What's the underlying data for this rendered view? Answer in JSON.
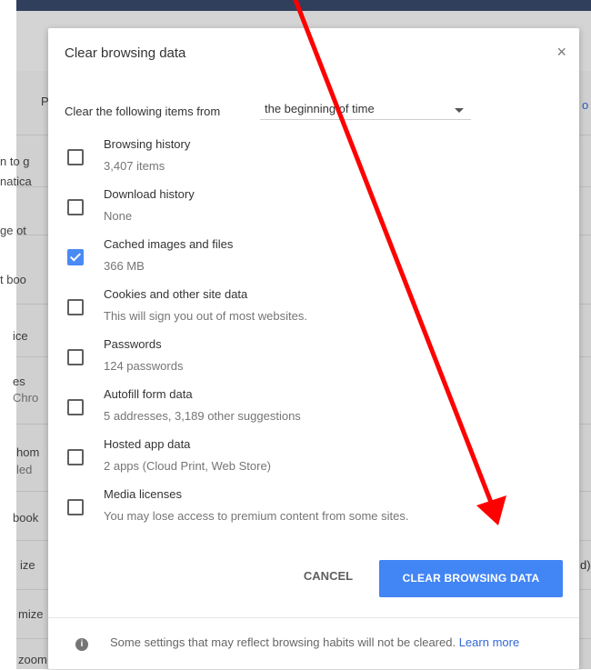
{
  "background": {
    "fragments": [
      {
        "text": "P"
      },
      {
        "text": "n to g"
      },
      {
        "text": "natica"
      },
      {
        "text": "ge ot"
      },
      {
        "text": "t boo"
      },
      {
        "text": "ice"
      },
      {
        "text": "es"
      },
      {
        "text": "Chro"
      },
      {
        "text": "hom"
      },
      {
        "text": "led"
      },
      {
        "text": "book"
      },
      {
        "text": "ize"
      },
      {
        "text": "mize"
      },
      {
        "text": "zoom"
      }
    ],
    "right_fragments": [
      "o",
      "d)"
    ]
  },
  "dialog": {
    "title": "Clear browsing data",
    "close_label": "×",
    "range": {
      "label": "Clear the following items from",
      "value": "the beginning of time"
    },
    "options": [
      {
        "label": "Browsing history",
        "sub": "3,407 items",
        "checked": false
      },
      {
        "label": "Download history",
        "sub": "None",
        "checked": false
      },
      {
        "label": "Cached images and files",
        "sub": "366 MB",
        "checked": true
      },
      {
        "label": "Cookies and other site data",
        "sub": "This will sign you out of most websites.",
        "checked": false
      },
      {
        "label": "Passwords",
        "sub": "124 passwords",
        "checked": false
      },
      {
        "label": "Autofill form data",
        "sub": "5 addresses, 3,189 other suggestions",
        "checked": false
      },
      {
        "label": "Hosted app data",
        "sub": "2 apps (Cloud Print, Web Store)",
        "checked": false
      },
      {
        "label": "Media licenses",
        "sub": "You may lose access to premium content from some sites.",
        "checked": false
      }
    ],
    "buttons": {
      "cancel": "CANCEL",
      "clear": "CLEAR BROWSING DATA"
    },
    "footer": {
      "info_glyph": "i",
      "text": "Some settings that may reflect browsing habits will not be cleared.",
      "link": "Learn more"
    }
  },
  "colors": {
    "accent": "#4285f4",
    "annotation_arrow": "#ff0000"
  },
  "icons": [
    "close-icon",
    "chevron-down-icon",
    "check-icon",
    "info-icon",
    "red-arrow-annotation"
  ]
}
